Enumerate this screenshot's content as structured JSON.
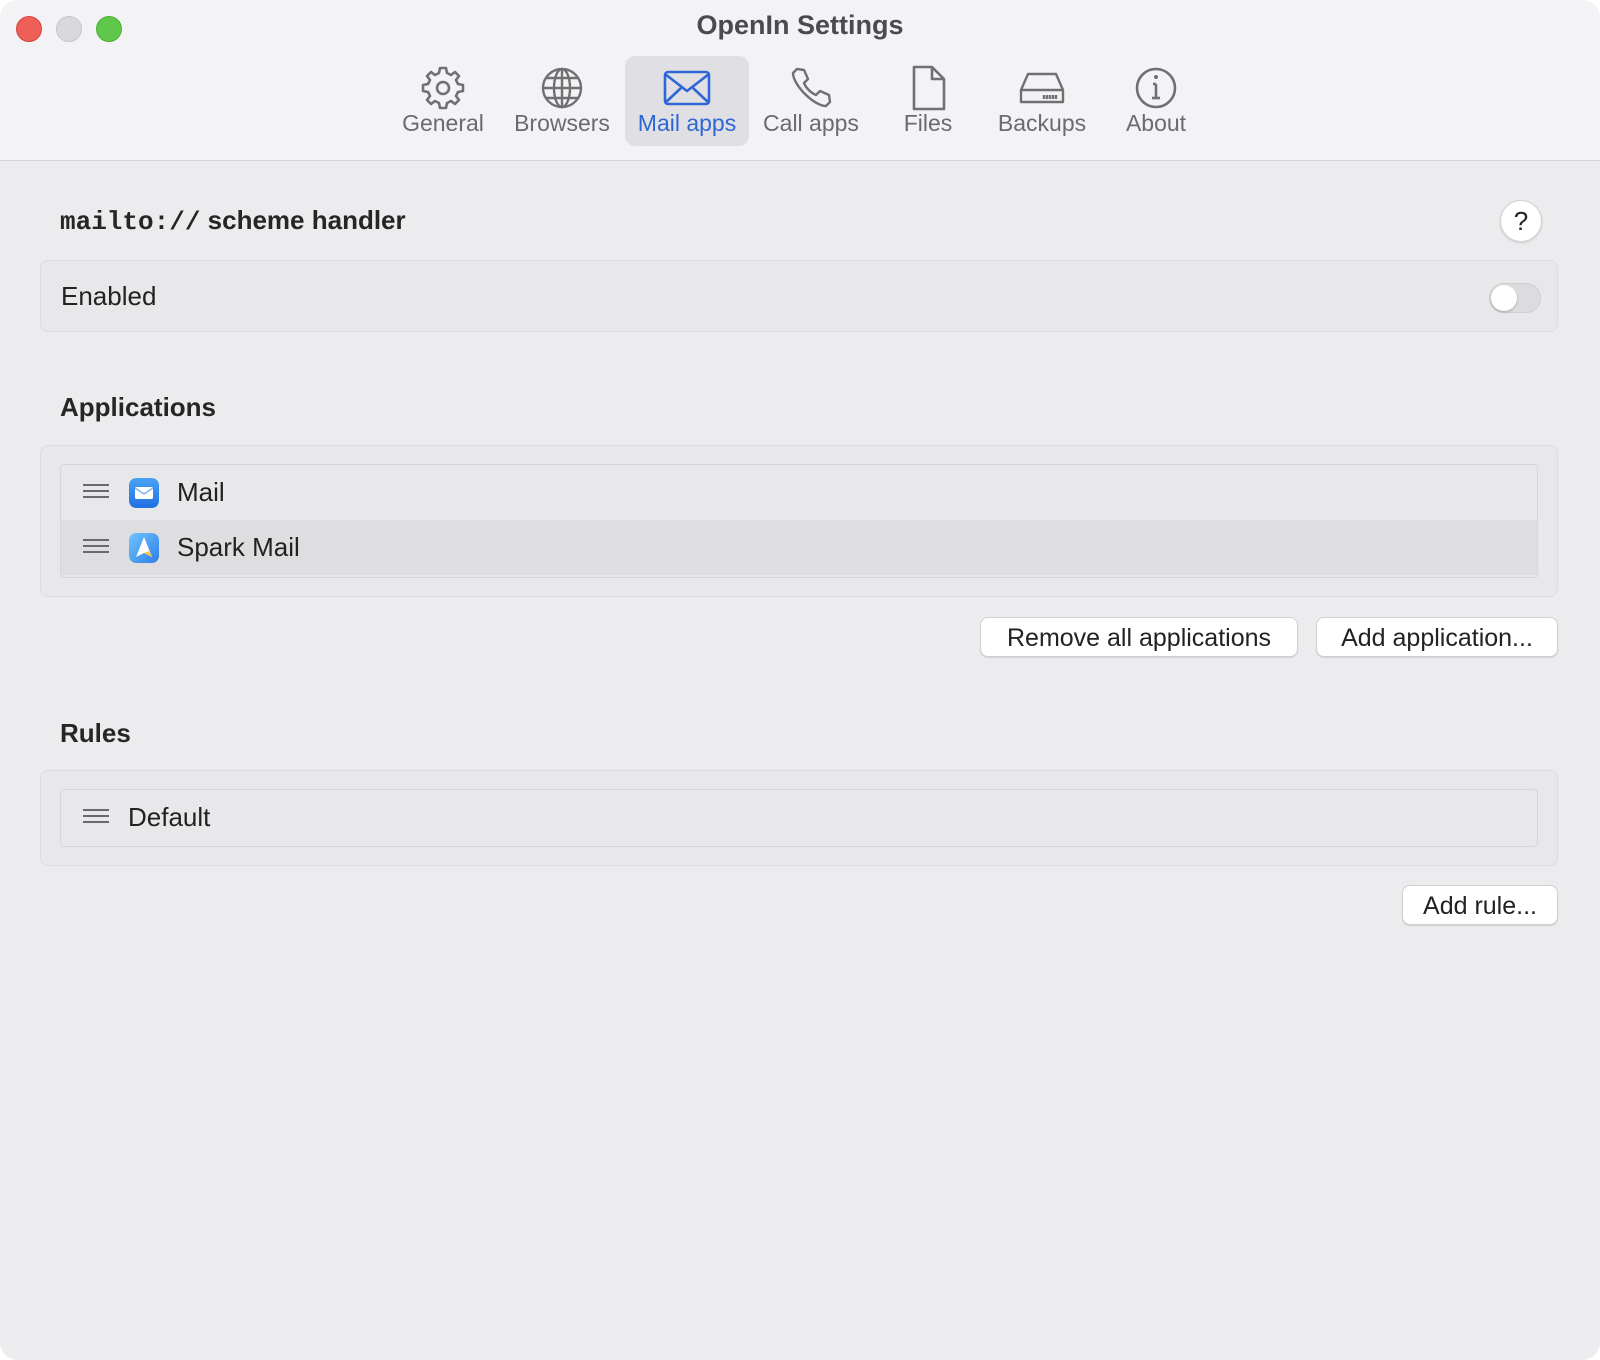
{
  "window": {
    "title": "OpenIn Settings"
  },
  "tabs": [
    {
      "label": "General",
      "icon": "gear-icon",
      "active": false
    },
    {
      "label": "Browsers",
      "icon": "globe-icon",
      "active": false
    },
    {
      "label": "Mail apps",
      "icon": "envelope-icon",
      "active": true
    },
    {
      "label": "Call apps",
      "icon": "phone-icon",
      "active": false
    },
    {
      "label": "Files",
      "icon": "document-icon",
      "active": false
    },
    {
      "label": "Backups",
      "icon": "drive-icon",
      "active": false
    },
    {
      "label": "About",
      "icon": "info-icon",
      "active": false
    }
  ],
  "handler": {
    "scheme": "mailto://",
    "suffix": " scheme handler",
    "help": "?",
    "enabled_label": "Enabled",
    "enabled": false
  },
  "applications": {
    "heading": "Applications",
    "items": [
      {
        "name": "Mail",
        "icon": "mail-app-icon"
      },
      {
        "name": "Spark Mail",
        "icon": "spark-mail-app-icon"
      }
    ],
    "remove_all_label": "Remove all applications",
    "add_label": "Add application..."
  },
  "rules": {
    "heading": "Rules",
    "items": [
      {
        "name": "Default"
      }
    ],
    "add_label": "Add rule..."
  },
  "colors": {
    "accent": "#2f66d6",
    "close": "#ed5f57",
    "minimize": "#d9d9db",
    "zoom": "#5fc84a"
  }
}
